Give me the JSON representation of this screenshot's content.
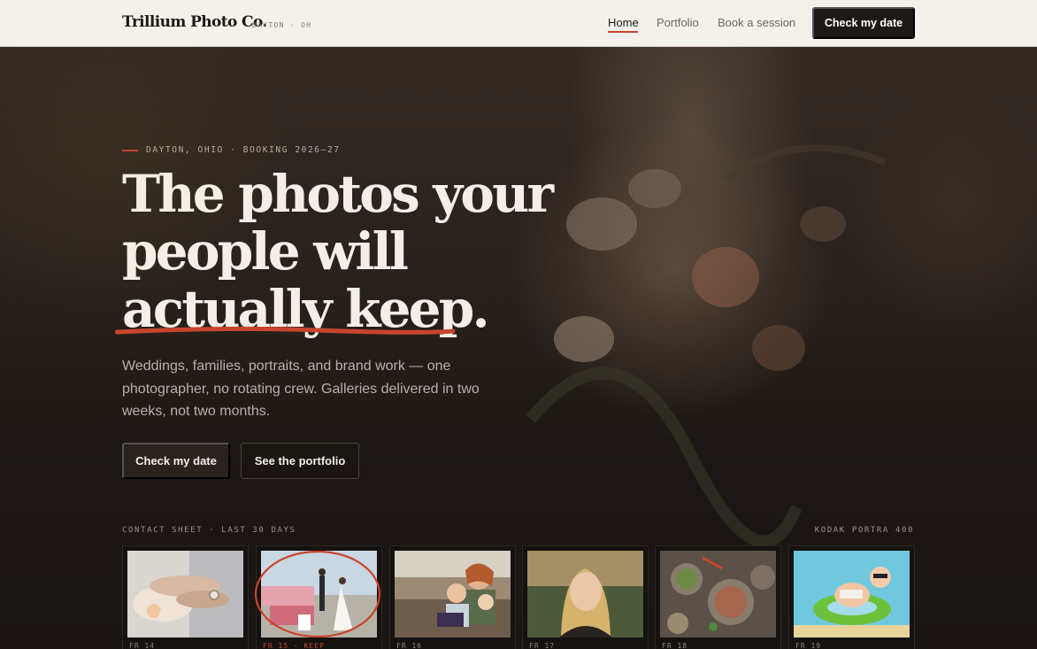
{
  "nav": {
    "brand": "Trillium Photo Co.",
    "location": "DAYTON · OH",
    "links": [
      {
        "label": "Home",
        "active": true
      },
      {
        "label": "Portfolio",
        "active": false
      },
      {
        "label": "Book a session",
        "active": false
      }
    ],
    "cta": "Check my date"
  },
  "hero": {
    "eyebrow": "DAYTON, OHIO · BOOKING 2026–27",
    "headline_lines": [
      "The photos your",
      "people will",
      "actually keep."
    ],
    "subtext": "Weddings, families, portraits, and brand work — one photographer, no rotating crew. Galleries delivered in two weeks, not two months.",
    "primary_button": "Check my date",
    "secondary_button": "See the portfolio"
  },
  "contact_sheet": {
    "label": "CONTACT SHEET · LAST 30 DAYS",
    "film": "KODAK PORTRA 400",
    "frames": [
      {
        "caption": "FR 14",
        "subject": "hands-with-ring-photo",
        "marked": false
      },
      {
        "caption": "FR 15 · KEEP",
        "subject": "wedding-ceremony-photo",
        "marked": true
      },
      {
        "caption": "FR 16",
        "subject": "family-on-couch-photo",
        "marked": false
      },
      {
        "caption": "FR 17",
        "subject": "woman-portrait-photo",
        "marked": false
      },
      {
        "caption": "FR 18",
        "subject": "food-table-photo",
        "marked": false
      },
      {
        "caption": "FR 19",
        "subject": "baby-in-pool-float-photo",
        "marked": false
      }
    ]
  },
  "colors": {
    "accent": "#c8452d",
    "nav_bg": "#f4f1ea",
    "hero_bg": "#1c1714",
    "headline": "#f3eee6"
  }
}
